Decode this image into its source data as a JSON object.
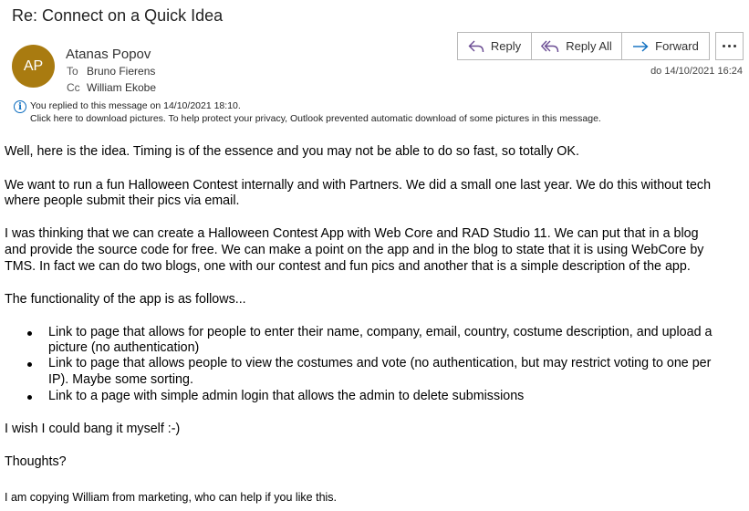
{
  "email": {
    "subject": "Re: Connect on a Quick Idea",
    "avatar_initials": "AP",
    "avatar_color": "#a97b10",
    "sender": "Atanas Popov",
    "to_label": "To",
    "to": "Bruno Fierens",
    "cc_label": "Cc",
    "cc": "William Ekobe",
    "date": "do 14/10/2021 16:24",
    "info_line1": "You replied to this message on 14/10/2021 18:10.",
    "info_line2": "Click here to download pictures. To help protect your privacy, Outlook prevented automatic download of some pictures in this message."
  },
  "actions": {
    "reply": "Reply",
    "reply_all": "Reply All",
    "forward": "Forward",
    "accent": "#6a4c93",
    "forward_color": "#0a6cbf"
  },
  "body": {
    "p1": "Well, here is the idea. Timing is of the essence and you may not be able to do so fast, so totally OK.",
    "p2_l1": "We want to run a fun Halloween Contest internally and with Partners. We did a small one last year. We do this without tech",
    "p2_l2": "where people submit their pics via email.",
    "p3_l1": "I was thinking that we can create a Halloween Contest App with Web Core and RAD Studio 11. We can put that in a blog",
    "p3_l2": "and provide the source code for free. We can make a point on the app and in the blog to state that it is using WebCore by",
    "p3_l3": "TMS. In fact we can do two blogs, one with our contest and fun pics and another that is a simple description of the app.",
    "p4": "The functionality of the app is as follows...",
    "li1_l1": "Link to page that allows for people to enter their name, company, email, country, costume description, and upload a",
    "li1_l2": "picture (no authentication)",
    "li2_l1": "Link to page that allows people to view the costumes and vote (no authentication, but may restrict voting to one per",
    "li2_l2": "IP). Maybe some sorting.",
    "li3": "Link to a page with simple admin login that allows the admin to delete submissions",
    "p5": "I wish I could bang it myself :-)",
    "p6": "Thoughts?",
    "p7": "I am copying William from marketing, who can help if you like this."
  }
}
